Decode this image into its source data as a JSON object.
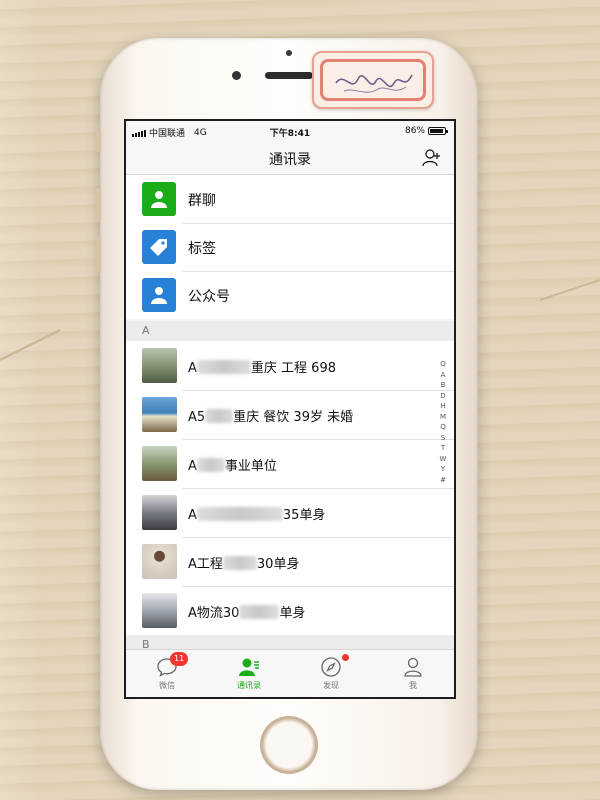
{
  "status_bar": {
    "carrier": "中国联通",
    "network": "4G",
    "time": "下午8:41",
    "battery": "86%"
  },
  "nav": {
    "title": "通讯录",
    "add_friend_icon": "add-friend-icon"
  },
  "special_items": [
    {
      "label": "群聊",
      "icon": "group-chat-icon",
      "color": "#1aad19"
    },
    {
      "label": "标签",
      "icon": "tag-icon",
      "color": "#2782d7"
    },
    {
      "label": "公众号",
      "icon": "official-account-icon",
      "color": "#2782d7"
    }
  ],
  "sections": {
    "a": "A",
    "b": "B"
  },
  "contacts": [
    {
      "prefix": "A",
      "suffix": "重庆 工程 698",
      "avatar_color": "#7a8a6a"
    },
    {
      "prefix": "A5",
      "suffix": "重庆 餐饮 39岁 未婚",
      "avatar_color": "#3f7fb8"
    },
    {
      "prefix": "A",
      "suffix": "事业单位",
      "avatar_color": "#6b7f52"
    },
    {
      "prefix": "A",
      "suffix": "35单身",
      "avatar_color": "#5a5e66"
    },
    {
      "prefix": "A工程",
      "suffix": "30单身",
      "avatar_color": "#c9c2b5"
    },
    {
      "prefix": "A物流30",
      "suffix": "单身",
      "avatar_color": "#9aa0a8"
    }
  ],
  "index_letters": [
    "Q",
    "A",
    "B",
    "D",
    "H",
    "M",
    "Q",
    "S",
    "T",
    "W",
    "Y",
    "#"
  ],
  "tabs": [
    {
      "label": "微信",
      "icon": "chat-bubble-icon",
      "badge": "11"
    },
    {
      "label": "通讯录",
      "icon": "contacts-icon",
      "active": true
    },
    {
      "label": "发现",
      "icon": "compass-icon",
      "dot": true
    },
    {
      "label": "我",
      "icon": "person-icon"
    }
  ],
  "colors": {
    "accent": "#1aad19",
    "badge": "#f43530"
  }
}
